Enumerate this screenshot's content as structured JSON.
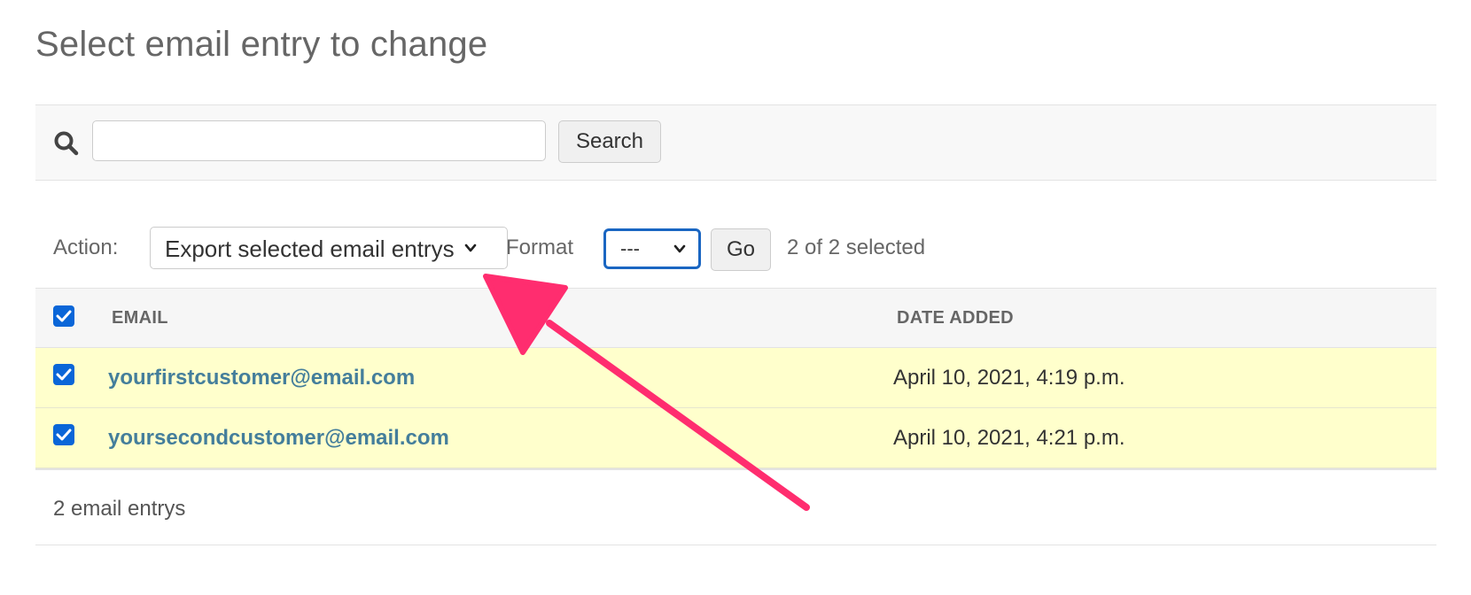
{
  "page_title": "Select email entry to change",
  "search": {
    "value": "",
    "placeholder": "",
    "button_label": "Search"
  },
  "actions": {
    "label": "Action:",
    "selected_action": "Export selected email entrys",
    "format_label": "Format",
    "format_value": "---",
    "go_label": "Go",
    "selection_count": "2 of 2 selected"
  },
  "table": {
    "columns": [
      "EMAIL",
      "DATE ADDED"
    ],
    "rows": [
      {
        "email": "yourfirstcustomer@email.com",
        "date_added": "April 10, 2021, 4:19 p.m.",
        "checked": true
      },
      {
        "email": "yoursecondcustomer@email.com",
        "date_added": "April 10, 2021, 4:21 p.m.",
        "checked": true
      }
    ],
    "header_checked": true
  },
  "result_count": "2 email entrys",
  "colors": {
    "link": "#447e9b",
    "selected_row": "#ffffcc",
    "checkbox": "#0a66d8",
    "focus_border": "#1a66c2",
    "annotation_arrow": "#ff2d6f"
  },
  "icons": {
    "search": "search-icon",
    "chevron": "chevron-down-icon",
    "check": "checkmark-icon",
    "annotation": "arrow-annotation"
  }
}
